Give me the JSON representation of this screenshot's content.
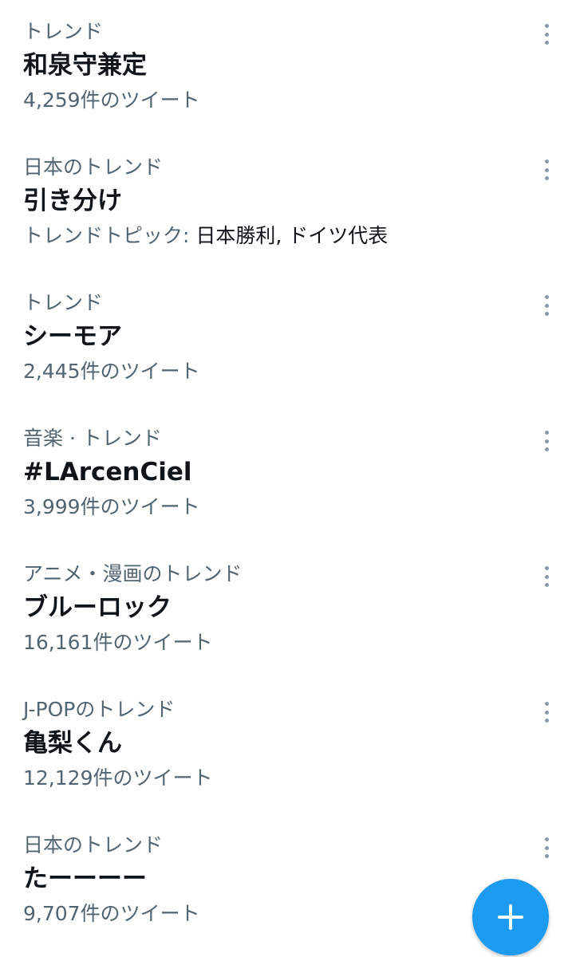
{
  "trends": [
    {
      "context": "トレンド",
      "name": "和泉守兼定",
      "meta": "4,259件のツイート"
    },
    {
      "context": "日本のトレンド",
      "name": "引き分け",
      "meta_label": "トレンドトピック: ",
      "meta_topics": "日本勝利, ドイツ代表"
    },
    {
      "context": "トレンド",
      "name": "シーモア",
      "meta": "2,445件のツイート"
    },
    {
      "context": "音楽 · トレンド",
      "name": "#LArcenCiel",
      "meta": "3,999件のツイート"
    },
    {
      "context": "アニメ・漫画のトレンド",
      "name": "ブルーロック",
      "meta": "16,161件のツイート"
    },
    {
      "context": "J-POPのトレンド",
      "name": "亀梨くん",
      "meta": "12,129件のツイート"
    },
    {
      "context": "日本のトレンド",
      "name": "たーーーー",
      "meta": "9,707件のツイート"
    }
  ],
  "icons": {
    "more": "more-vertical-icon",
    "compose": "plus-icon"
  },
  "colors": {
    "accent": "#1d9bf0",
    "secondary_text": "#536471",
    "primary_text": "#0f1419",
    "background": "#ffffff"
  }
}
